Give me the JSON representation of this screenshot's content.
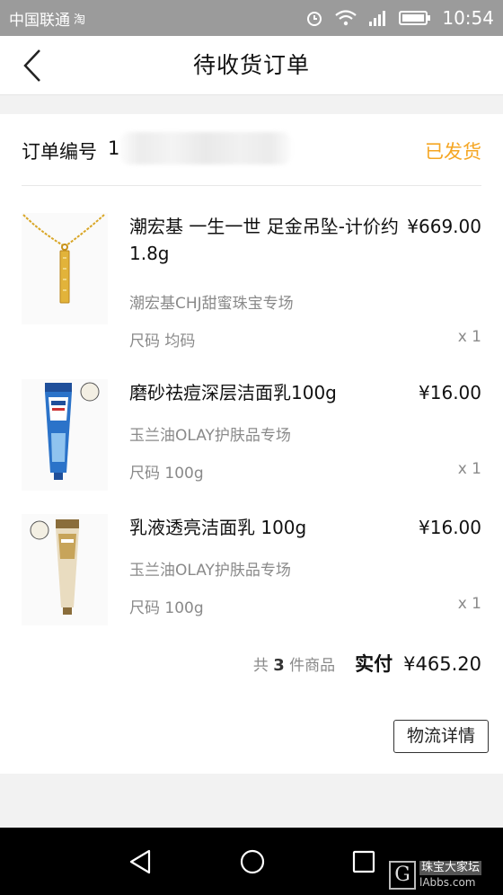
{
  "status_bar": {
    "carrier": "中国联通",
    "carrier_tag": "淘",
    "time": "10:54"
  },
  "header": {
    "title": "待收货订单"
  },
  "order": {
    "number_label": "订单编号",
    "number_visible": "1",
    "status": "已发货",
    "status_color": "#f5a623"
  },
  "items": [
    {
      "name": "潮宏基 一生一世 足金吊坠-计价约1.8g",
      "price": "¥669.00",
      "shop": "潮宏基CHJ甜蜜珠宝专场",
      "spec": "尺码 均码",
      "qty": "x 1"
    },
    {
      "name": "磨砂祛痘深层洁面乳100g",
      "price": "¥16.00",
      "shop": "玉兰油OLAY护肤品专场",
      "spec": "尺码 100g",
      "qty": "x 1"
    },
    {
      "name": "乳液透亮洁面乳 100g",
      "price": "¥16.00",
      "shop": "玉兰油OLAY护肤品专场",
      "spec": "尺码 100g",
      "qty": "x 1"
    }
  ],
  "summary": {
    "count_prefix": "共",
    "count": "3",
    "count_suffix": "件商品",
    "paid_label": "实付",
    "paid_amount": "¥465.20"
  },
  "actions": {
    "logistics": "物流详情"
  },
  "watermark": {
    "letter": "G",
    "name": "珠宝大家坛",
    "site": "lAbbs.com"
  },
  "icons": {
    "back": "chevron-left-icon",
    "nav_back": "triangle-back-icon",
    "nav_home": "circle-home-icon",
    "nav_recent": "square-recent-icon"
  }
}
